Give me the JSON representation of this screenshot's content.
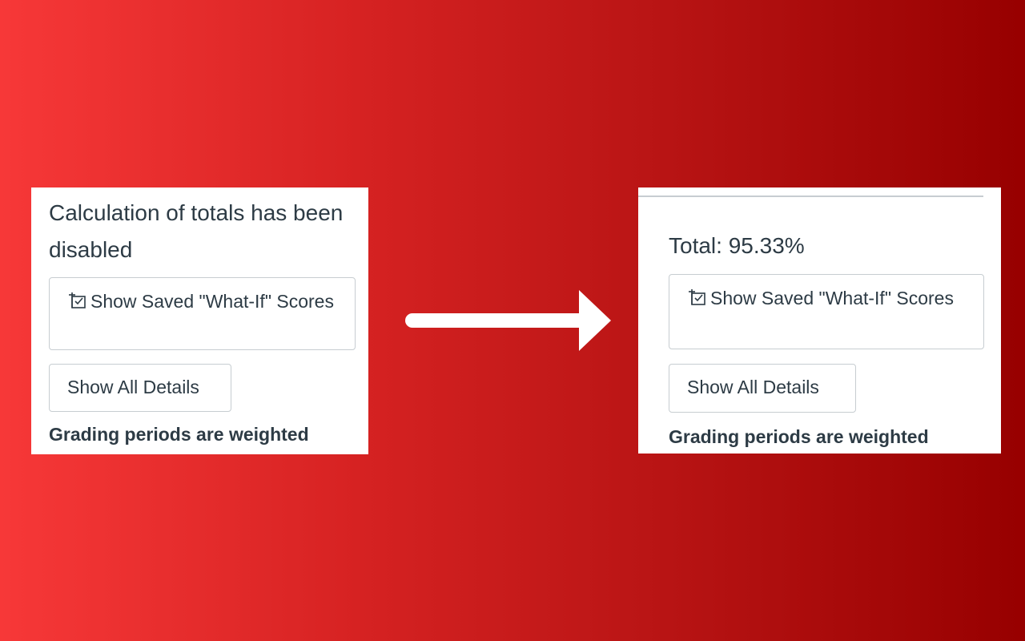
{
  "before_panel": {
    "status_text": "Calculation of totals has been disabled",
    "whatif_button": {
      "icon": "what-if-scores-icon",
      "label": "Show Saved \"What-If\" Scores"
    },
    "details_button": {
      "label": "Show All Details"
    },
    "weighting_note": "Grading periods are weighted"
  },
  "transition_arrow": {
    "icon": "right-arrow-icon",
    "color": "#ffffff"
  },
  "after_panel": {
    "status_text": "Total: 95.33%",
    "whatif_button": {
      "icon": "what-if-scores-icon",
      "label": "Show Saved \"What-If\" Scores"
    },
    "details_button": {
      "label": "Show All Details"
    },
    "weighting_note": "Grading periods are weighted"
  },
  "colors": {
    "background_start": "#f73838",
    "background_end": "#970000",
    "panel": "#ffffff",
    "text": "#2d3b45",
    "border": "#c7cdd1"
  }
}
